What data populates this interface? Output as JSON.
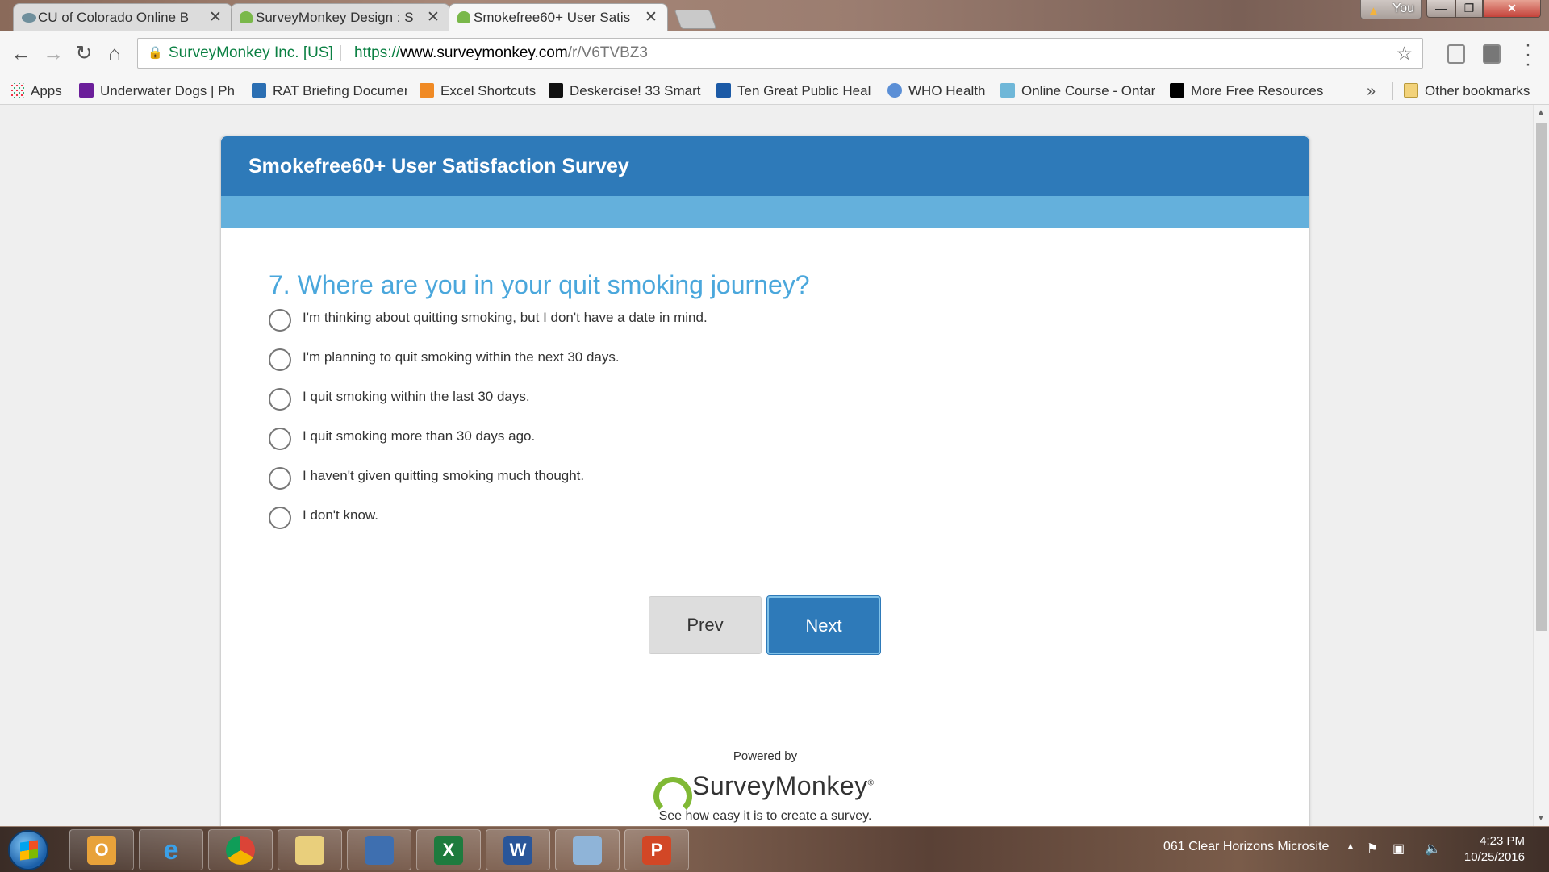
{
  "browser": {
    "tabs": [
      {
        "title": "CU of Colorado Online B",
        "icon": "cu-colorado-favicon",
        "active": false
      },
      {
        "title": "SurveyMonkey Design : S",
        "icon": "surveymonkey-favicon",
        "active": false
      },
      {
        "title": "Smokefree60+ User Satis",
        "icon": "surveymonkey-favicon",
        "active": true
      }
    ],
    "profile_label": "You",
    "window_controls": {
      "minimize": "—",
      "maximize": "❐",
      "close": "✕"
    },
    "omnibox": {
      "secure_org": "SurveyMonkey Inc. [US]",
      "url_scheme": "https://",
      "url_host": "www.surveymonkey.com",
      "url_path": "/r/V6TVBZ3"
    },
    "bookmarks": [
      "Apps",
      "Underwater Dogs | Ph",
      "RAT Briefing Documen",
      "Excel Shortcuts",
      "Deskercise! 33 Smart",
      "Ten Great Public Heal",
      "WHO Health",
      "Online Course - Ontar",
      "More Free Resources"
    ],
    "bookmarks_overflow": "»",
    "other_bookmarks": "Other bookmarks"
  },
  "survey": {
    "title": "Smokefree60+ User Satisfaction Survey",
    "question": "7. Where are you in your quit smoking journey?",
    "options": [
      "I'm thinking about quitting smoking, but I don't have a date in mind.",
      "I'm planning to quit smoking within the next 30 days.",
      "I quit smoking within the last 30 days.",
      "I quit smoking more than 30 days ago.",
      "I haven't given quitting smoking much thought.",
      "I don't know."
    ],
    "prev_label": "Prev",
    "next_label": "Next",
    "powered_by": "Powered by",
    "brand": "SurveyMonkey",
    "brand_mark": "®",
    "create_link": "See how easy it is to create a survey."
  },
  "colors": {
    "header_blue": "#2e7ab9",
    "progress_blue": "#64b0dc",
    "question_blue": "#4aa7dc",
    "logo_green": "#80b935"
  },
  "taskbar": {
    "apps": [
      "outlook-icon",
      "internet-explorer-icon",
      "chrome-icon",
      "file-explorer-icon",
      "remote-desktop-icon",
      "excel-icon",
      "word-icon",
      "paint-icon",
      "powerpoint-icon"
    ],
    "tray_label": "061 Clear Horizons Microsite",
    "time": "4:23 PM",
    "date": "10/25/2016"
  }
}
